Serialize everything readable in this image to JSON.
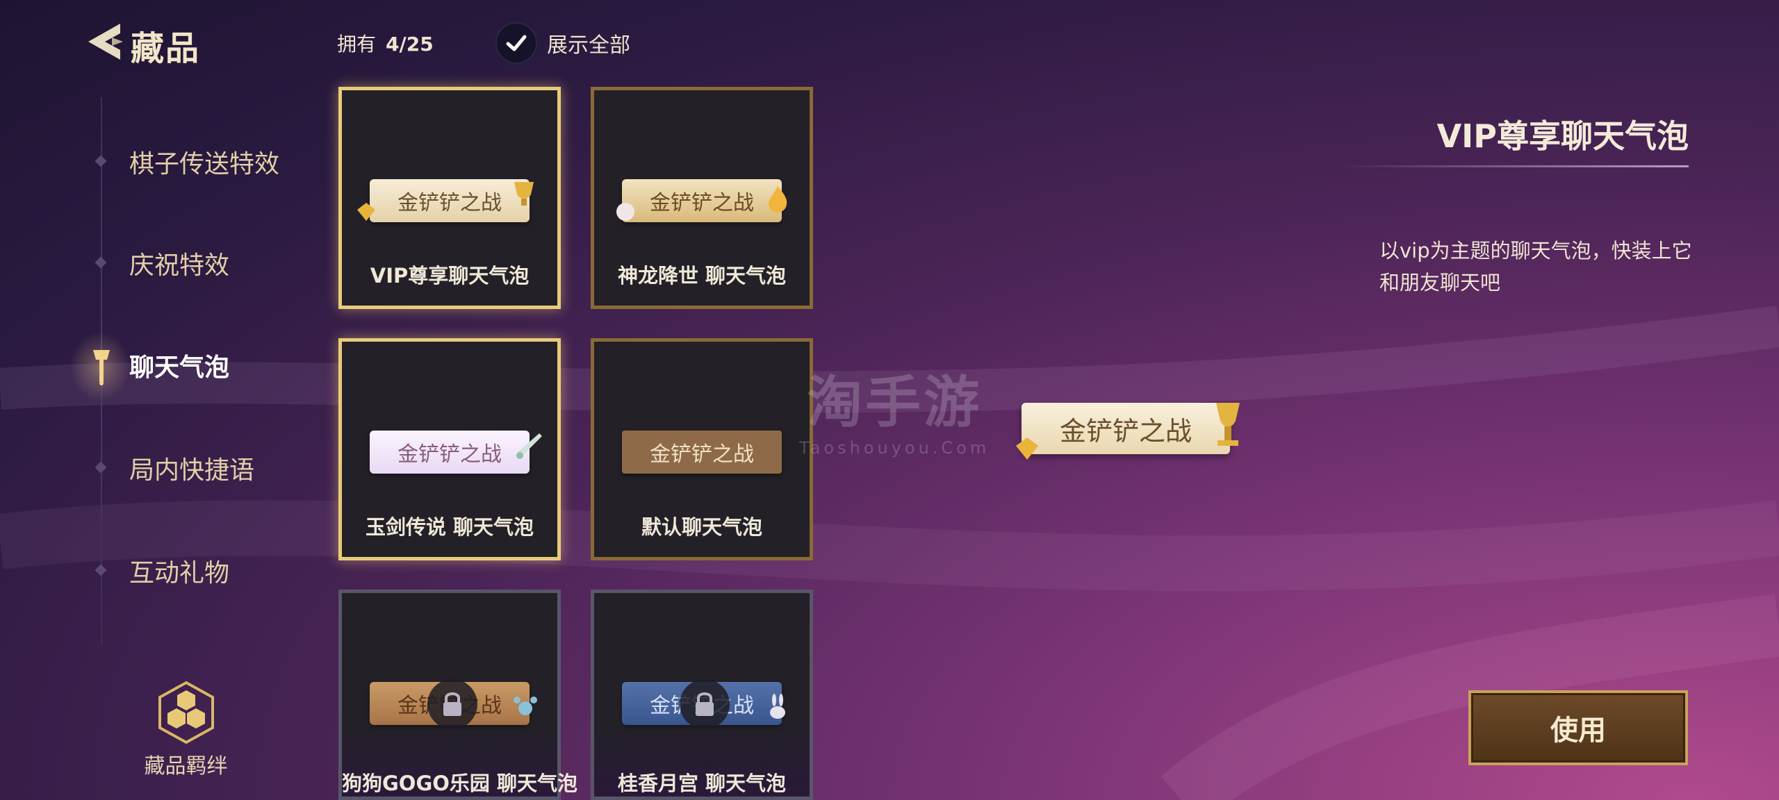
{
  "header": {
    "title": "藏品",
    "owned_label": "拥有",
    "owned_count": "4/25",
    "show_all_label": "展示全部"
  },
  "sidebar": {
    "items": [
      {
        "label": "棋子传送特效"
      },
      {
        "label": "庆祝特效"
      },
      {
        "label": "聊天气泡"
      },
      {
        "label": "局内快捷语"
      },
      {
        "label": "互动礼物"
      }
    ],
    "active_index": 2,
    "bond_label": "藏品羁绊"
  },
  "cards": [
    {
      "name": "VIP尊享聊天气泡",
      "bubble_text": "金铲铲之战",
      "locked": false,
      "selected": true
    },
    {
      "name": "神龙降世  聊天气泡",
      "bubble_text": "金铲铲之战",
      "locked": false,
      "selected": false
    },
    {
      "name": "玉剑传说  聊天气泡",
      "bubble_text": "金铲铲之战",
      "locked": false,
      "selected": false
    },
    {
      "name": "默认聊天气泡",
      "bubble_text": "金铲铲之战",
      "locked": false,
      "selected": false
    },
    {
      "name": "狗狗GOGO乐园  聊天气泡",
      "bubble_text": "金铲铲之战",
      "locked": true,
      "selected": false
    },
    {
      "name": "桂香月宫  聊天气泡",
      "bubble_text": "金铲铲之战",
      "locked": true,
      "selected": false
    }
  ],
  "watermark": {
    "big": "淘手游",
    "small": "Taoshouyou.Com"
  },
  "preview": {
    "bubble_text": "金铲铲之战"
  },
  "detail": {
    "title": "VIP尊享聊天气泡",
    "description": "以vip为主题的聊天气泡，快装上它和朋友聊天吧",
    "use_button": "使用"
  },
  "colors": {
    "gold_border": "#e8cb7a",
    "bronze_border": "#8a6a36",
    "locked_border": "#5a566a",
    "accent_text": "#e2cfa8"
  }
}
